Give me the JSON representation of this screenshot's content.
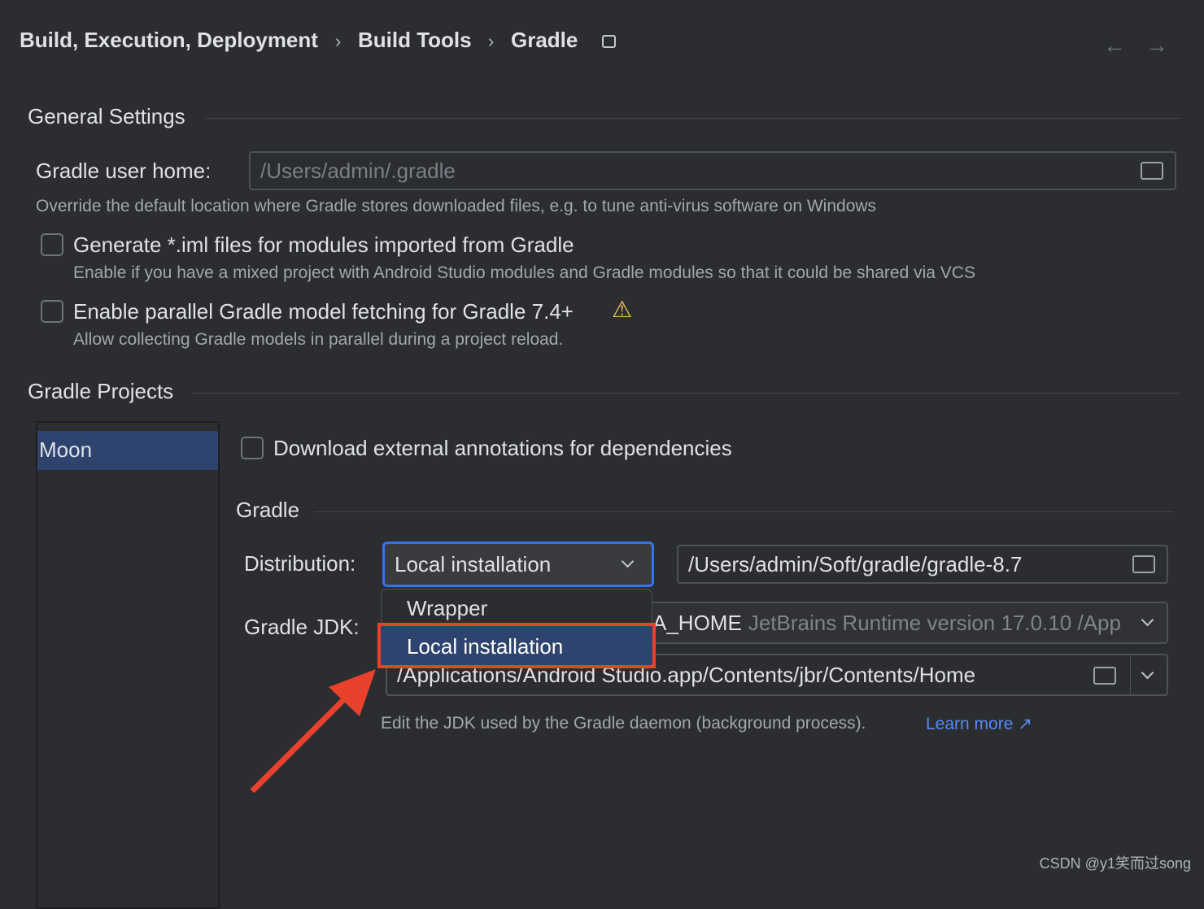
{
  "breadcrumb": [
    "Build, Execution, Deployment",
    "Build Tools",
    "Gradle"
  ],
  "general": {
    "title": "General Settings",
    "user_home_label": "Gradle user home:",
    "user_home_placeholder": "/Users/admin/.gradle",
    "user_home_hint": "Override the default location where Gradle stores downloaded files, e.g. to tune anti-virus software on Windows",
    "iml_label": "Generate *.iml files for modules imported from Gradle",
    "iml_hint": "Enable if you have a mixed project with Android Studio modules and Gradle modules so that it could be shared via VCS",
    "parallel_label": "Enable parallel Gradle model fetching for Gradle 7.4+",
    "parallel_hint": "Allow collecting Gradle models in parallel during a project reload."
  },
  "projects": {
    "title": "Gradle Projects",
    "items": [
      "Moon"
    ],
    "download_label": "Download external annotations for dependencies",
    "gradle_title": "Gradle",
    "distribution_label": "Distribution:",
    "distribution_value": "Local installation",
    "distribution_path": "/Users/admin/Soft/gradle/gradle-8.7",
    "dropdown_options": [
      "Wrapper",
      "Local installation"
    ],
    "jdk_label": "Gradle JDK:",
    "jdk_value_prefix": "A_HOME",
    "jdk_value_detail": "JetBrains Runtime version 17.0.10 /App",
    "jdk_path": "/Applications/Android Studio.app/Contents/jbr/Contents/Home",
    "jdk_hint": "Edit the JDK used by the Gradle daemon (background process).",
    "learn_more": "Learn more ↗"
  },
  "watermark": "CSDN @y1笑而过song",
  "colors": {
    "bg": "#2b2d30",
    "selection": "#2e436e",
    "focus": "#3574f0",
    "annotation": "#e8412c",
    "link": "#548af7",
    "warning": "#f2c55c"
  }
}
